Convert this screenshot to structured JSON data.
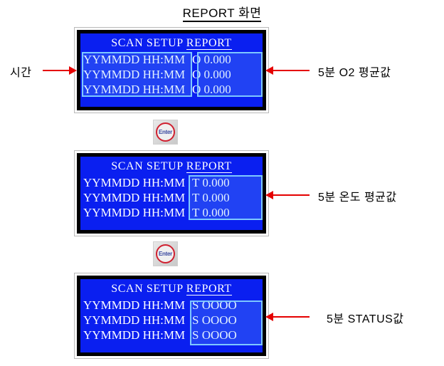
{
  "title": "REPORT 화면",
  "screens": [
    {
      "name": "o2-report-screen",
      "header_prefix": "SCAN SETUP ",
      "header_highlight": "REPORT",
      "rows": [
        {
          "time": "YYMMDD HH:MM",
          "value": "O 0.000"
        },
        {
          "time": "YYMMDD HH:MM",
          "value": "O 0.000"
        },
        {
          "time": "YYMMDD HH:MM",
          "value": "O 0.000"
        }
      ]
    },
    {
      "name": "temperature-report-screen",
      "header_prefix": "SCAN SETUP ",
      "header_highlight": "REPORT",
      "rows": [
        {
          "time": "YYMMDD HH:MM",
          "value": "T 0.000"
        },
        {
          "time": "YYMMDD HH:MM",
          "value": "T 0.000"
        },
        {
          "time": "YYMMDD HH:MM",
          "value": "T 0.000"
        }
      ]
    },
    {
      "name": "status-report-screen",
      "header_prefix": "SCAN SETUP ",
      "header_highlight": "REPORT",
      "rows": [
        {
          "time": "YYMMDD HH:MM",
          "value": "S OOOO"
        },
        {
          "time": "YYMMDD HH:MM",
          "value": "S OOOO"
        },
        {
          "time": "YYMMDD HH:MM",
          "value": "S OOOO"
        }
      ]
    }
  ],
  "enter_keys": [
    {
      "label": "Enter"
    },
    {
      "label": "Enter"
    }
  ],
  "annotations": {
    "time_left": "시간",
    "o2_avg": "5분 O2 평균값",
    "temp_avg": "5분 온도 평균값",
    "status_val": "5분 STATUS값"
  },
  "colors": {
    "screen_blue": "#0a1ff0",
    "screen_text": "#ffffff",
    "highlight_border": "#7ec8ff",
    "arrow_red": "#e50000",
    "enter_ring": "#d02030",
    "enter_text": "#3b4aa0"
  }
}
